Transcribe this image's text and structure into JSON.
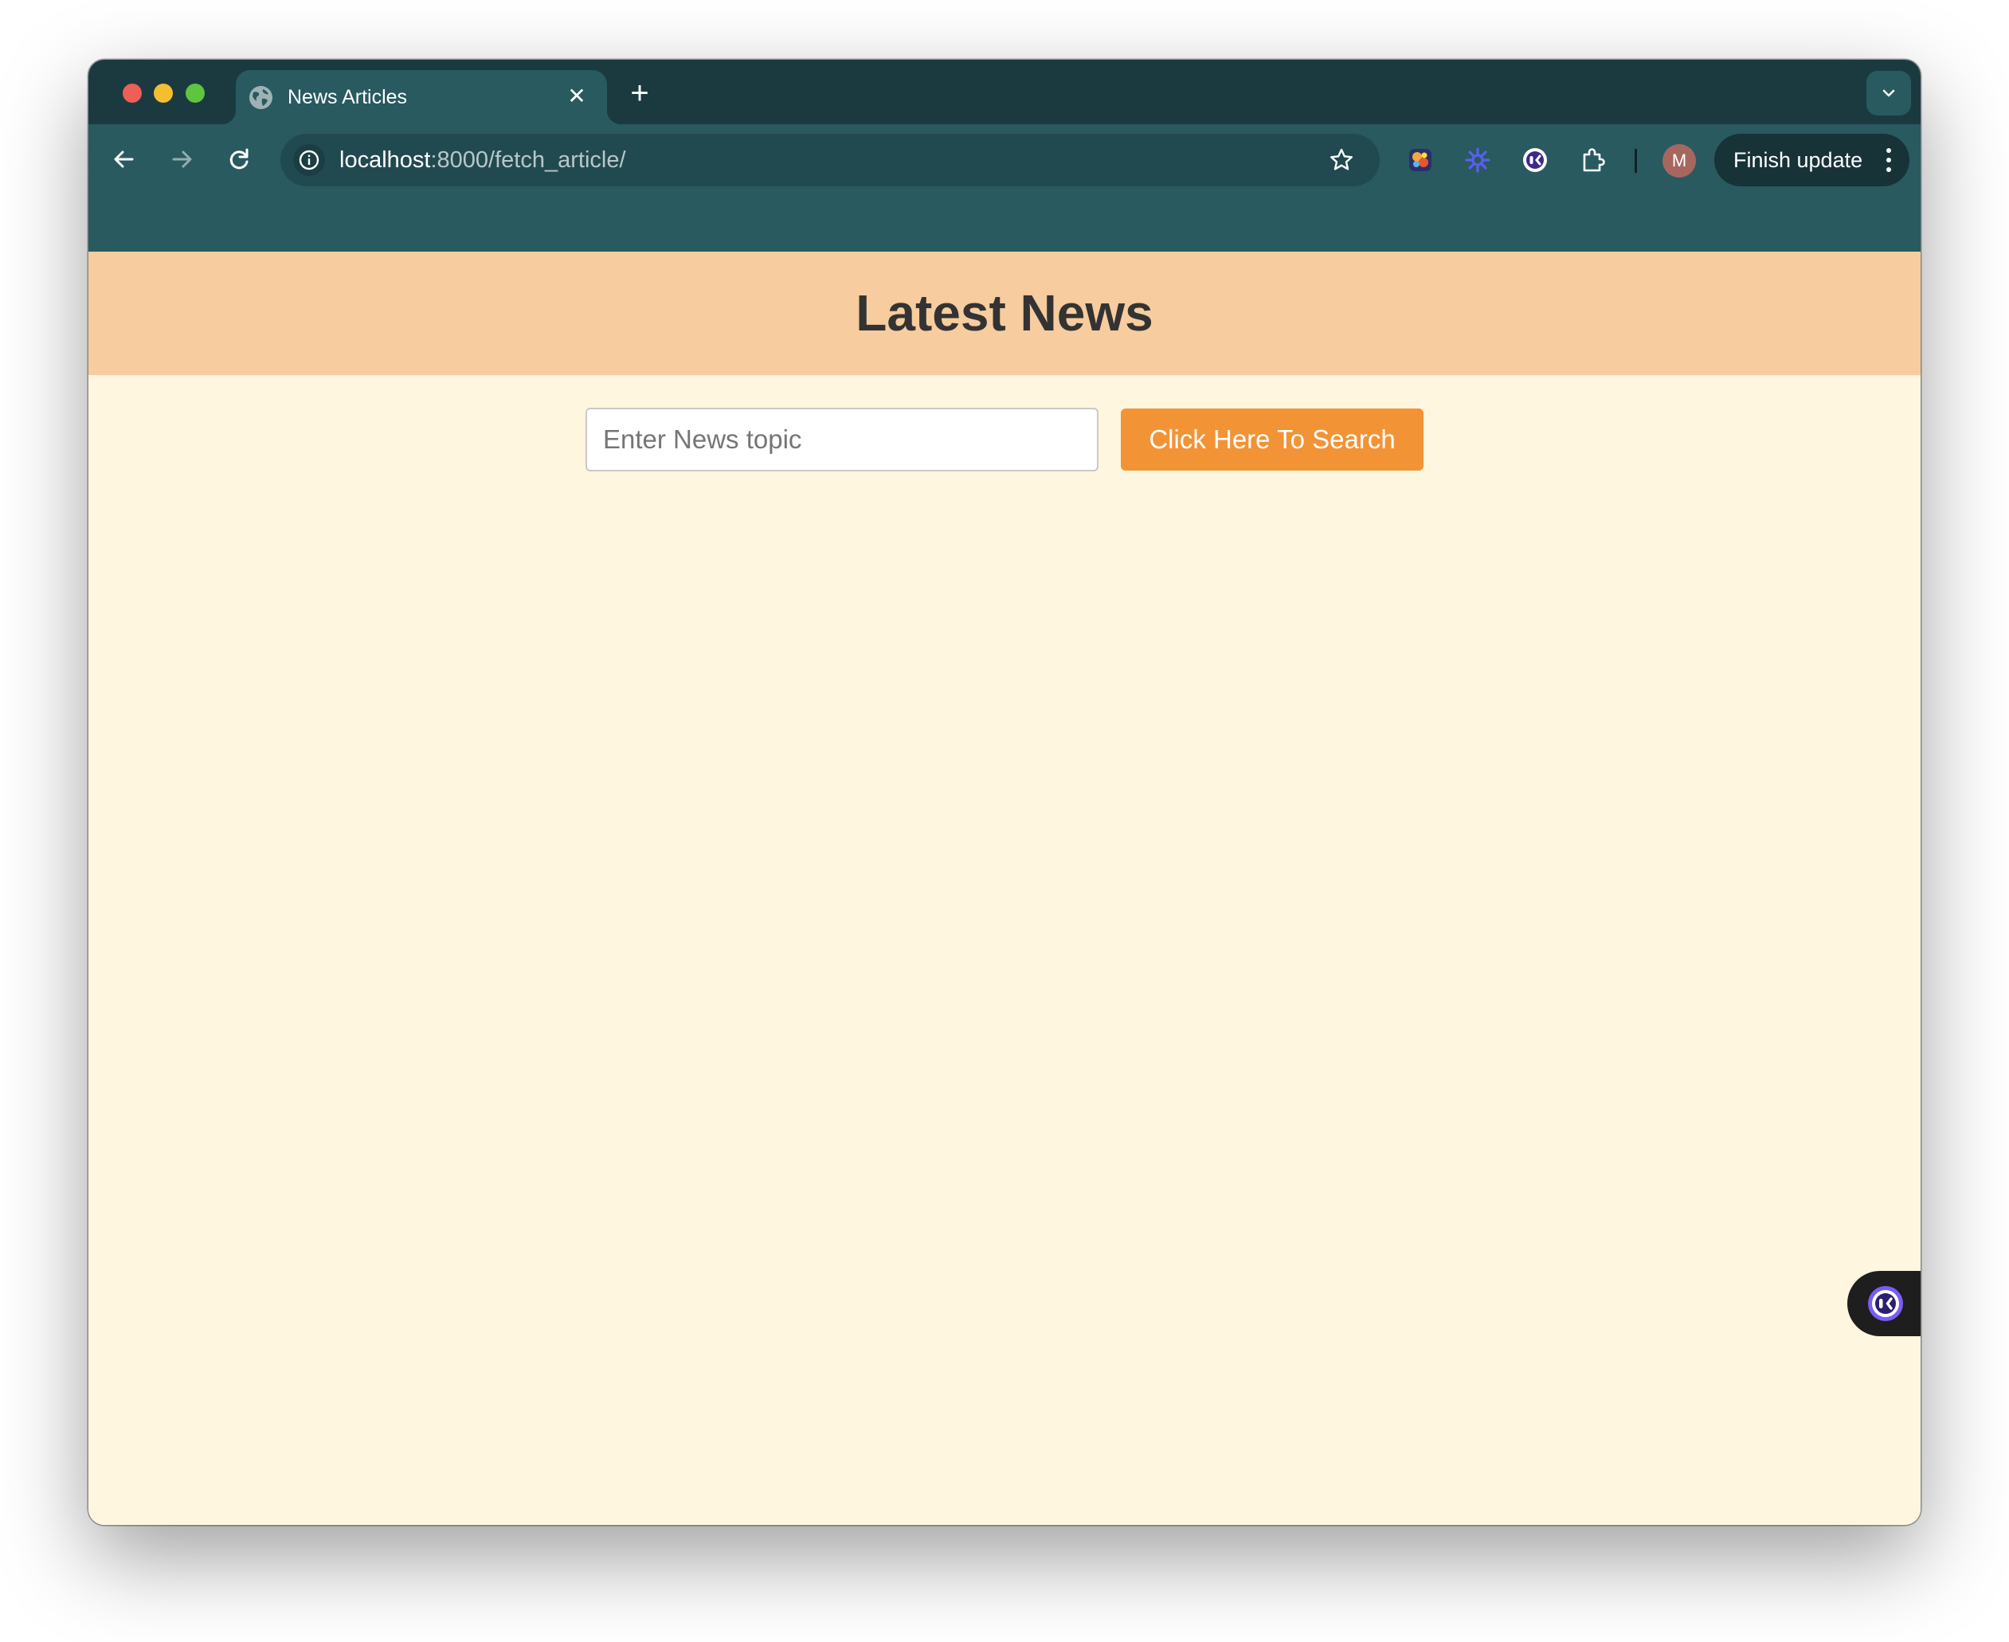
{
  "browser": {
    "tab": {
      "title": "News Articles",
      "favicon": "globe-icon"
    },
    "address_bar": {
      "host": "localhost",
      "path": ":8000/fetch_article/"
    },
    "profile_initial": "M",
    "update_button_label": "Finish update",
    "extensions": [
      "colorful-extension-icon",
      "sparkle-extension-icon",
      "assistant-extension-icon",
      "puzzle-extension-icon"
    ]
  },
  "page": {
    "title": "Latest News",
    "search": {
      "placeholder": "Enter News topic",
      "value": "",
      "button_label": "Click Here To Search"
    }
  },
  "colors": {
    "tabstrip": "#1b3a40",
    "toolbar": "#285a60",
    "header_band": "#f7cc9e",
    "page_background": "#fef6df",
    "search_button": "#f29336",
    "title_text": "#333333"
  }
}
